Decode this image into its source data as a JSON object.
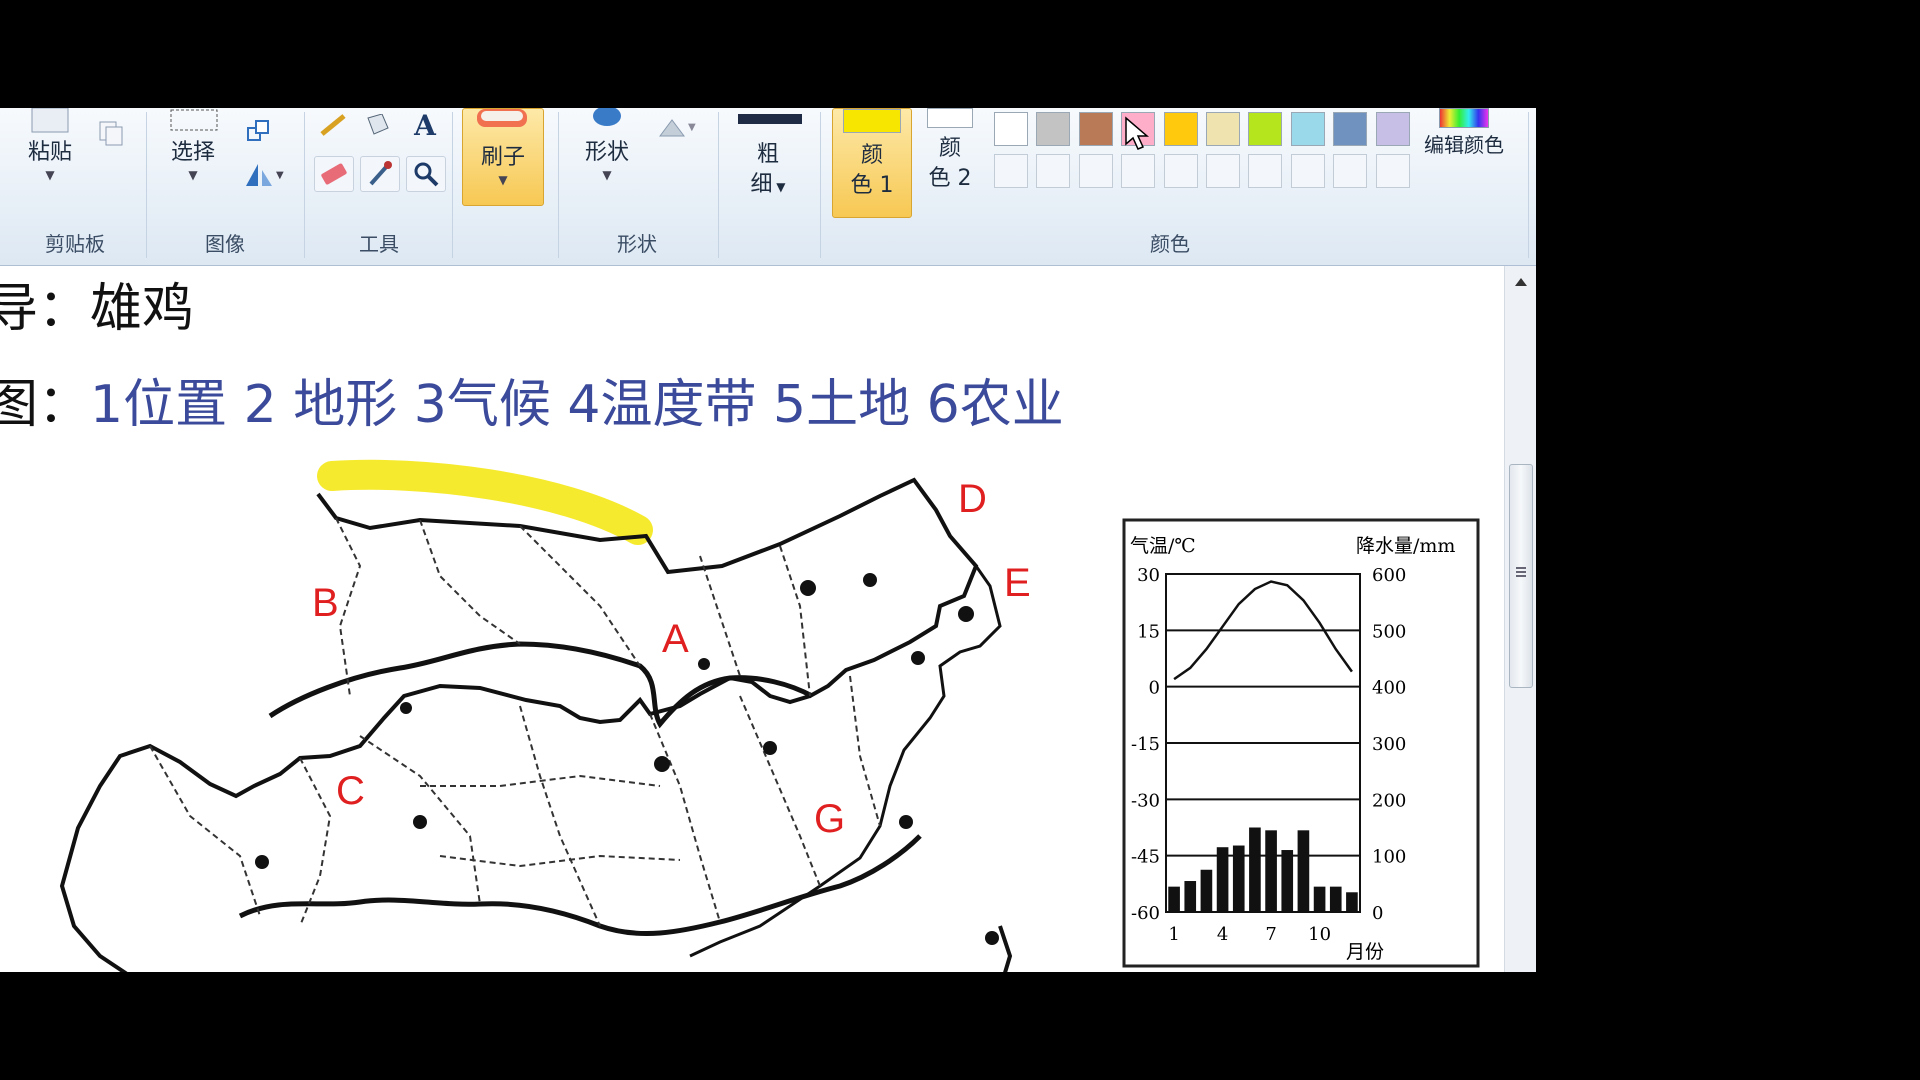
{
  "ribbon": {
    "clipboard": {
      "paste_label": "粘贴",
      "group_label": "剪贴板"
    },
    "image": {
      "select_label": "选择",
      "group_label": "图像"
    },
    "tools": {
      "group_label": "工具",
      "text_tool_glyph": "A"
    },
    "brush": {
      "label": "刷子"
    },
    "shapes": {
      "label": "形状",
      "group_label": "形状"
    },
    "size": {
      "label_line1": "粗",
      "label_line2": "细"
    },
    "color1": {
      "label_line1": "颜",
      "label_line2": "色 1",
      "color": "#f7e600"
    },
    "color2": {
      "label_line1": "颜",
      "label_line2": "色 2",
      "color": "#ffffff"
    },
    "palette": {
      "group_label": "颜色",
      "row1": [
        "#ffffff",
        "#c3c3c3",
        "#b97a57",
        "#ffaec9",
        "#ffc90e",
        "#efe4b0",
        "#b5e61d",
        "#99d9ea",
        "#7092be",
        "#c8bfe7"
      ],
      "edit_colors_label": "编辑颜色"
    }
  },
  "canvas": {
    "line1": "导：雄鸡",
    "line2_lead": "图：",
    "line2_items": "1位置 2 地形  3气候  4温度带 5土地  6农业",
    "map": {
      "labels": [
        "A",
        "B",
        "C",
        "D",
        "E",
        "G"
      ],
      "label_color": "#e02020",
      "highlight_color": "#f5e60a"
    },
    "climate_chart": {
      "left_axis_title": "气温/℃",
      "right_axis_title": "降水量/mm",
      "x_unit": "月份",
      "temp_ticks": [
        "30",
        "15",
        "0",
        "-15",
        "-30",
        "-45",
        "-60"
      ],
      "precip_ticks": [
        "600",
        "500",
        "400",
        "300",
        "200",
        "100",
        "0"
      ],
      "x_ticks": [
        "1",
        "4",
        "7",
        "10"
      ]
    }
  },
  "chart_data": {
    "type": "bar",
    "title": "",
    "xlabel": "月份",
    "ylabel": "气温/℃",
    "y2label": "降水量/mm",
    "categories": [
      "1",
      "2",
      "3",
      "4",
      "5",
      "6",
      "7",
      "8",
      "9",
      "10",
      "11",
      "12"
    ],
    "temperature_ylim": [
      -60,
      30
    ],
    "precipitation_ylim": [
      0,
      600
    ],
    "series": [
      {
        "kind": "line",
        "axis": "temperature",
        "values": [
          2,
          5,
          10,
          16,
          22,
          26,
          28,
          27,
          23,
          17,
          10,
          4
        ]
      },
      {
        "kind": "bar",
        "axis": "precipitation",
        "values": [
          45,
          55,
          75,
          115,
          118,
          150,
          145,
          110,
          145,
          45,
          45,
          35
        ]
      }
    ]
  }
}
